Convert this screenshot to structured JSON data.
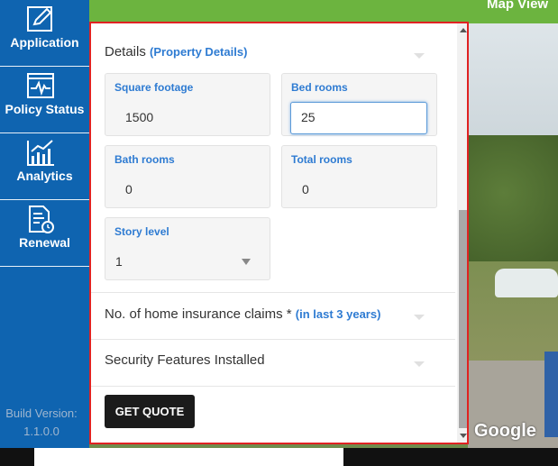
{
  "sidebar": {
    "items": [
      {
        "label": "Application",
        "icon": "edit-icon"
      },
      {
        "label": "Policy Status",
        "icon": "pulse-icon"
      },
      {
        "label": "Analytics",
        "icon": "chart-icon"
      },
      {
        "label": "Renewal",
        "icon": "document-clock-icon"
      }
    ],
    "build_label": "Build Version:",
    "build_version": "1.1.0.0"
  },
  "map": {
    "tab_label": "Map View",
    "attribution": "Google"
  },
  "details": {
    "title": "Details",
    "subtitle": "(Property Details)",
    "fields": {
      "square_footage": {
        "label": "Square footage",
        "value": "1500"
      },
      "bed_rooms": {
        "label": "Bed rooms",
        "value": "25"
      },
      "bath_rooms": {
        "label": "Bath rooms",
        "value": "0"
      },
      "total_rooms": {
        "label": "Total rooms",
        "value": "0"
      },
      "story_level": {
        "label": "Story level",
        "value": "1"
      }
    }
  },
  "claims": {
    "title": "No. of home insurance claims *",
    "subtitle": "(in last 3 years)"
  },
  "security": {
    "title": "Security Features Installed"
  },
  "actions": {
    "get_quote": "GET QUOTE"
  }
}
